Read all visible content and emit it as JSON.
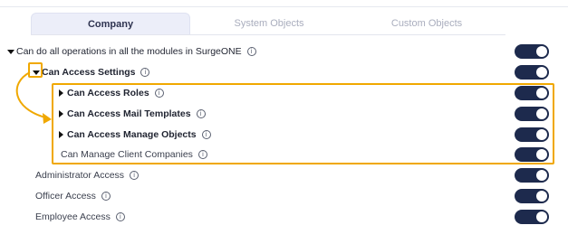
{
  "tabs": [
    {
      "label": "Company",
      "active": true
    },
    {
      "label": "System Objects",
      "active": false
    },
    {
      "label": "Custom Objects",
      "active": false
    }
  ],
  "permissions": [
    {
      "label": "Can do all operations in all the modules in SurgeONE",
      "expanded": true,
      "level": 0,
      "enabled": true
    },
    {
      "label": "Can Access Settings",
      "expanded": true,
      "level": 1,
      "enabled": true
    },
    {
      "label": "Can Access Roles",
      "expanded": false,
      "level": 2,
      "enabled": true
    },
    {
      "label": "Can Access Mail Templates",
      "expanded": false,
      "level": 2,
      "enabled": true
    },
    {
      "label": "Can Access Manage Objects",
      "expanded": false,
      "level": 2,
      "enabled": true
    },
    {
      "label": "Can Manage Client Companies",
      "level": 2,
      "enabled": true
    },
    {
      "label": "Administrator Access",
      "level": 1,
      "enabled": true
    },
    {
      "label": "Officer Access",
      "level": 1,
      "enabled": true
    },
    {
      "label": "Employee Access",
      "level": 1,
      "enabled": true
    }
  ],
  "info_icon": "info-circle-icon",
  "colors": {
    "toggle_on": "#1d2a4d",
    "highlight": "#f0a800",
    "tab_active_bg": "#eceef9"
  }
}
